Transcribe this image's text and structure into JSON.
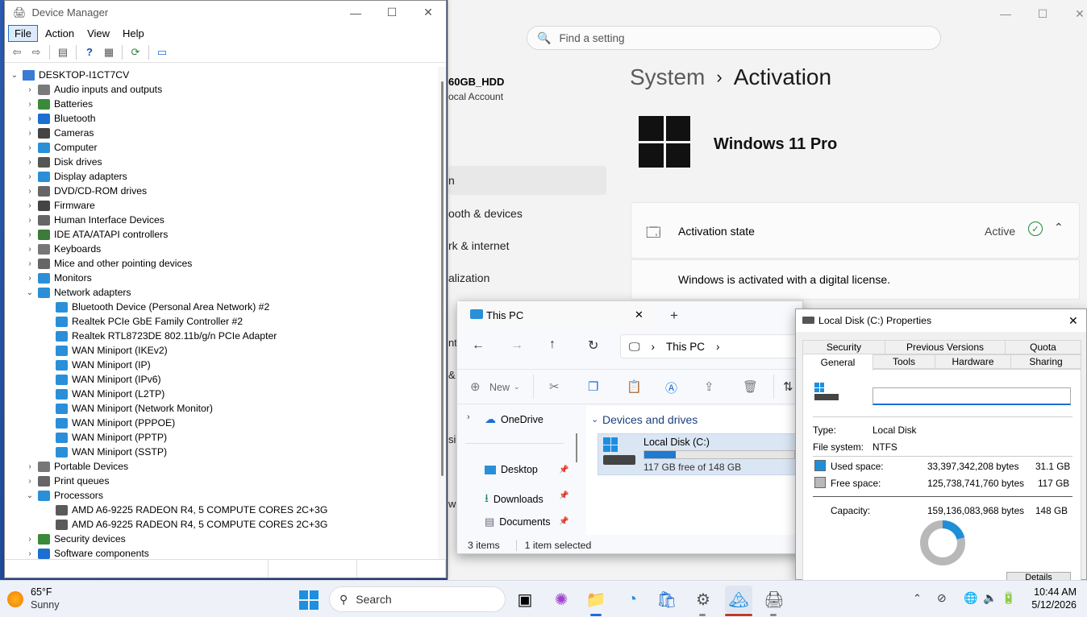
{
  "device_manager": {
    "title": "Device Manager",
    "menu": [
      "File",
      "Action",
      "View",
      "Help"
    ],
    "root": "DESKTOP-I1CT7CV",
    "tree": [
      {
        "label": "Audio inputs and outputs",
        "level": 1,
        "expanded": false
      },
      {
        "label": "Batteries",
        "level": 1,
        "expanded": false
      },
      {
        "label": "Bluetooth",
        "level": 1,
        "expanded": false
      },
      {
        "label": "Cameras",
        "level": 1,
        "expanded": false
      },
      {
        "label": "Computer",
        "level": 1,
        "expanded": false
      },
      {
        "label": "Disk drives",
        "level": 1,
        "expanded": false
      },
      {
        "label": "Display adapters",
        "level": 1,
        "expanded": false
      },
      {
        "label": "DVD/CD-ROM drives",
        "level": 1,
        "expanded": false
      },
      {
        "label": "Firmware",
        "level": 1,
        "expanded": false
      },
      {
        "label": "Human Interface Devices",
        "level": 1,
        "expanded": false
      },
      {
        "label": "IDE ATA/ATAPI controllers",
        "level": 1,
        "expanded": false
      },
      {
        "label": "Keyboards",
        "level": 1,
        "expanded": false
      },
      {
        "label": "Mice and other pointing devices",
        "level": 1,
        "expanded": false
      },
      {
        "label": "Monitors",
        "level": 1,
        "expanded": false
      },
      {
        "label": "Network adapters",
        "level": 1,
        "expanded": true
      },
      {
        "label": "Bluetooth Device (Personal Area Network) #2",
        "level": 2
      },
      {
        "label": "Realtek PCIe GbE Family Controller #2",
        "level": 2
      },
      {
        "label": "Realtek RTL8723DE 802.11b/g/n PCIe Adapter",
        "level": 2
      },
      {
        "label": "WAN Miniport (IKEv2)",
        "level": 2
      },
      {
        "label": "WAN Miniport (IP)",
        "level": 2
      },
      {
        "label": "WAN Miniport (IPv6)",
        "level": 2
      },
      {
        "label": "WAN Miniport (L2TP)",
        "level": 2
      },
      {
        "label": "WAN Miniport (Network Monitor)",
        "level": 2
      },
      {
        "label": "WAN Miniport (PPPOE)",
        "level": 2
      },
      {
        "label": "WAN Miniport (PPTP)",
        "level": 2
      },
      {
        "label": "WAN Miniport (SSTP)",
        "level": 2
      },
      {
        "label": "Portable Devices",
        "level": 1,
        "expanded": false
      },
      {
        "label": "Print queues",
        "level": 1,
        "expanded": false
      },
      {
        "label": "Processors",
        "level": 1,
        "expanded": true
      },
      {
        "label": "AMD A6-9225 RADEON R4, 5 COMPUTE CORES 2C+3G",
        "level": 2
      },
      {
        "label": "AMD A6-9225 RADEON R4, 5 COMPUTE CORES 2C+3G",
        "level": 2
      },
      {
        "label": "Security devices",
        "level": 1,
        "expanded": false
      },
      {
        "label": "Software components",
        "level": 1,
        "expanded": false
      }
    ]
  },
  "settings": {
    "search_placeholder": "Find a setting",
    "user_name": "60GB_HDD",
    "account": "ocal Account",
    "nav": [
      "n",
      "ooth & devices",
      "rk & internet",
      "alization"
    ],
    "breadcrumb_parent": "System",
    "breadcrumb_sep": "›",
    "breadcrumb_current": "Activation",
    "edition": "Windows 11 Pro",
    "activation_state_label": "Activation state",
    "activation_state_value": "Active",
    "activation_message": "Windows is activated with a digital license.",
    "partial_nav": [
      "nt",
      "&",
      "sib",
      "w"
    ]
  },
  "explorer": {
    "tab_title": "This PC",
    "address": "This PC",
    "new_label": "New",
    "sidebar": [
      {
        "label": "OneDrive"
      },
      {
        "label": "Desktop",
        "pinned": true
      },
      {
        "label": "Downloads",
        "pinned": true
      },
      {
        "label": "Documents",
        "pinned": true
      }
    ],
    "section_title": "Devices and drives",
    "drive_name": "Local Disk (C:)",
    "drive_free": "117 GB free of 148 GB",
    "drive_used_fraction": 0.21,
    "status_items": "3 items",
    "status_selected": "1 item selected"
  },
  "properties": {
    "title": "Local Disk (C:) Properties",
    "tabs_row1": [
      "Security",
      "Previous Versions",
      "Quota"
    ],
    "tabs_row2": [
      "General",
      "Tools",
      "Hardware",
      "Sharing"
    ],
    "name_value": "",
    "type_label": "Type:",
    "type_value": "Local Disk",
    "fs_label": "File system:",
    "fs_value": "NTFS",
    "used_label": "Used space:",
    "used_bytes": "33,397,342,208 bytes",
    "used_gb": "31.1 GB",
    "free_label": "Free space:",
    "free_bytes": "125,738,741,760 bytes",
    "free_gb": "117 GB",
    "cap_label": "Capacity:",
    "cap_bytes": "159,136,083,968 bytes",
    "cap_gb": "148 GB",
    "details_button": "Details",
    "used_fraction": 0.21,
    "colors": {
      "used": "#1e8ed8",
      "free": "#b8b8b8"
    }
  },
  "taskbar": {
    "weather_temp": "65°F",
    "weather_desc": "Sunny",
    "search_label": "Search",
    "time": "10:44 AM",
    "date": "5/12/2026"
  }
}
